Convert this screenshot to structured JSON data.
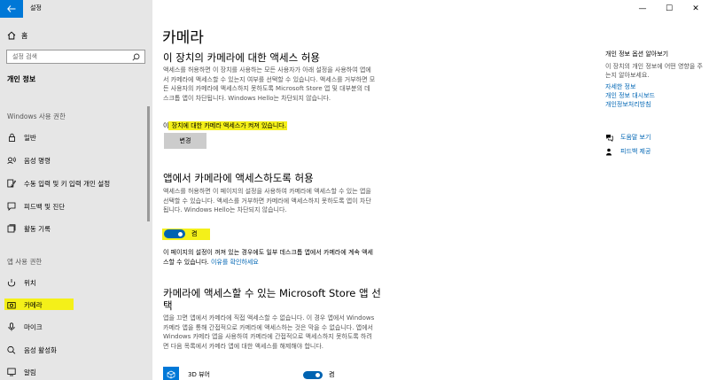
{
  "app": {
    "title": "설정"
  },
  "sidebar": {
    "home_label": "홈",
    "search_placeholder": "설정 검색",
    "category": "개인 정보",
    "windows_section": "Windows 사용 권한",
    "windows_items": [
      {
        "label": "일반",
        "icon": "lock-icon"
      },
      {
        "label": "음성 명령",
        "icon": "speech-icon"
      },
      {
        "label": "수동 입력 및 키 입력 개인 설정",
        "icon": "pen-icon"
      },
      {
        "label": "피드백 및 진단",
        "icon": "feedback-icon"
      },
      {
        "label": "활동 기록",
        "icon": "history-icon"
      }
    ],
    "apps_section": "앱 사용 권한",
    "app_items": [
      {
        "label": "위치",
        "icon": "location-icon"
      },
      {
        "label": "카메라",
        "icon": "camera-icon",
        "selected": true
      },
      {
        "label": "마이크",
        "icon": "microphone-icon"
      },
      {
        "label": "음성 활성화",
        "icon": "voice-icon"
      },
      {
        "label": "알림",
        "icon": "notification-icon"
      }
    ]
  },
  "main": {
    "page_title": "카메라",
    "device_section": {
      "heading": "이 장치의 카메라에 대한 액세스 허용",
      "description": "액세스를 허용하면 이 장치를 사용하는 모든 사용자가 아래 설정을 사용하여 앱에서 카메라에 액세스할 수 있는지 여부를 선택할 수 있습니다. 액세스를 거부하면 모든 사용자의 카메라에 액세스하지 못하도록 Microsoft Store 앱 및 대부분의 데스크톱 앱이 차단됩니다. Windows Hello는 차단되지 않습니다.",
      "status_prefix": "이",
      "status_highlight": " 장치에 대한 카메라 액세스가 켜져 있습니다.",
      "change_button": "변경"
    },
    "apps_section": {
      "heading": "앱에서 카메라에 액세스하도록 허용",
      "description": "액세스를 허용하면 이 페이지의 설정을 사용하여 카메라에 액세스할 수 있는 앱을 선택할 수 있습니다. 액세스를 거부하면 카메라에 액세스하지 못하도록 앱이 차단됩니다. Windows Hello는 차단되지 않습니다.",
      "toggle_state": "켬",
      "toggle_on": true,
      "note": "이 페이지의 설정이 꺼져 있는 경우에도 일부 데스크톱 앱에서 카메라에 계속 액세스할 수 있습니다. ",
      "note_link": "이유를 확인하세요"
    },
    "store_section": {
      "heading_line1": "카메라에 액세스할 수 있는 Microsoft Store 앱 선",
      "heading_line2": "택",
      "description": "앱을 끄면 앱에서 카메라에 직접 액세스할 수 없습니다. 이 경우 앱에서 Windows 카메라 앱을 통해 간접적으로 카메라에 액세스하는 것은 막을 수 없습니다. 앱에서 Windows 카메라 앱을 사용하여 카메라에 간접적으로 액세스하지 못하도록 하려면 다음 목록에서 카메라 앱에 대한 액세스를 해제해야 합니다.",
      "apps": [
        {
          "name": "3D 뷰어",
          "state": "켬",
          "on": true
        }
      ]
    }
  },
  "right_panel": {
    "title": "개인 정보 옵션 알아보기",
    "text": "이 장치의 개인 정보에 어떤 영향을 주는지 알아보세요.",
    "links": [
      "자세한 정보",
      "개인 정보 대시보드",
      "개인정보처리방침"
    ],
    "help": [
      {
        "label": "도움말 보기",
        "icon": "help-icon"
      },
      {
        "label": "피드백 제공",
        "icon": "feedback-person-icon"
      }
    ]
  },
  "window_controls": {
    "minimize": "—",
    "maximize": "☐",
    "close": "✕"
  },
  "colors": {
    "accent": "#0078d7",
    "toggle_on": "#0063b1",
    "highlight": "#f4f019",
    "sidebar_bg": "#e6e6e6",
    "link": "#0066b4"
  }
}
